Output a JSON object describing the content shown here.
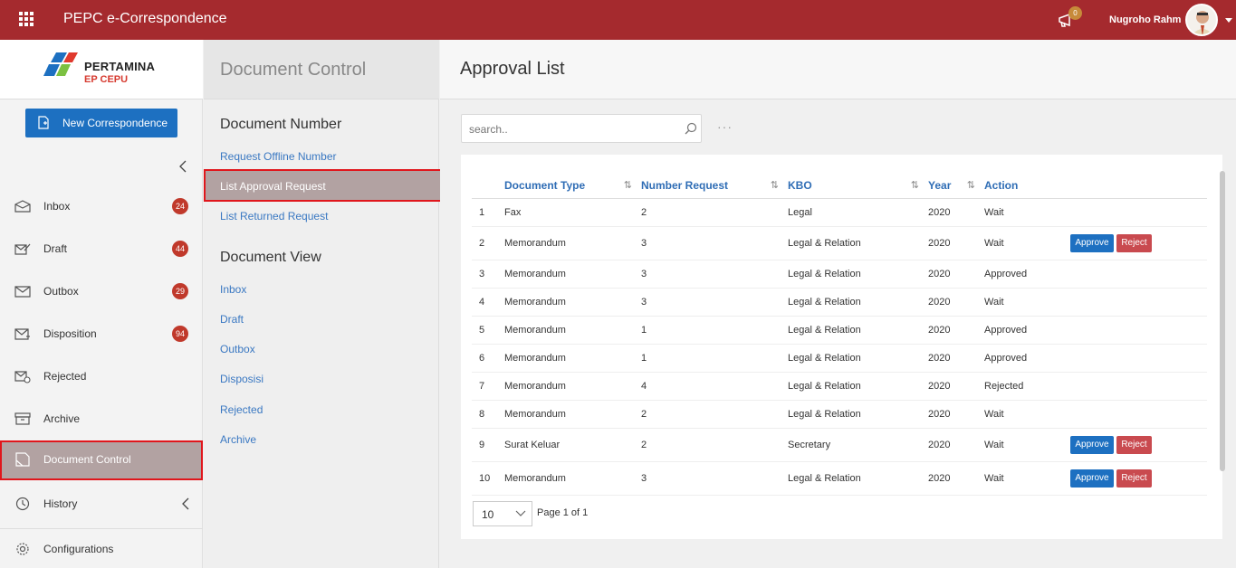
{
  "app": {
    "title": "PEPC e-Correspondence",
    "notification_count": "0",
    "user_name": "Nugroho Rahm"
  },
  "brand": {
    "name": "PERTAMINA",
    "sub": "EP CEPU"
  },
  "leftnav": {
    "new_button": "New Correspondence",
    "items": [
      {
        "label": "Inbox",
        "badge": "24",
        "icon": "inbox-icon"
      },
      {
        "label": "Draft",
        "badge": "44",
        "icon": "draft-icon"
      },
      {
        "label": "Outbox",
        "badge": "29",
        "icon": "outbox-icon"
      },
      {
        "label": "Disposition",
        "badge": "94",
        "icon": "disposition-icon"
      },
      {
        "label": "Rejected",
        "badge": "",
        "icon": "rejected-icon"
      },
      {
        "label": "Archive",
        "badge": "",
        "icon": "archive-icon"
      },
      {
        "label": "Document Control",
        "badge": "",
        "icon": "document-control-icon"
      },
      {
        "label": "History",
        "badge": "",
        "icon": "history-icon"
      },
      {
        "label": "Configurations",
        "badge": "",
        "icon": "gear-icon"
      }
    ]
  },
  "midpanel": {
    "title": "Document Control",
    "section1": "Document Number",
    "section1_links": [
      "Request Offline Number",
      "List Approval Request",
      "List Returned Request"
    ],
    "section2": "Document View",
    "section2_links": [
      "Inbox",
      "Draft",
      "Outbox",
      "Disposisi",
      "Rejected",
      "Archive"
    ]
  },
  "main": {
    "title": "Approval List",
    "search_placeholder": "search..",
    "columns": [
      "Document Type",
      "Number Request",
      "KBO",
      "Year",
      "Action"
    ],
    "rows": [
      {
        "no": "1",
        "type": "Fax",
        "num": "2",
        "kbo": "Legal",
        "year": "2020",
        "status": "Wait",
        "buttons": false
      },
      {
        "no": "2",
        "type": "Memorandum",
        "num": "3",
        "kbo": "Legal & Relation",
        "year": "2020",
        "status": "Wait",
        "buttons": true
      },
      {
        "no": "3",
        "type": "Memorandum",
        "num": "3",
        "kbo": "Legal & Relation",
        "year": "2020",
        "status": "Approved",
        "buttons": false
      },
      {
        "no": "4",
        "type": "Memorandum",
        "num": "3",
        "kbo": "Legal & Relation",
        "year": "2020",
        "status": "Wait",
        "buttons": false
      },
      {
        "no": "5",
        "type": "Memorandum",
        "num": "1",
        "kbo": "Legal & Relation",
        "year": "2020",
        "status": "Approved",
        "buttons": false
      },
      {
        "no": "6",
        "type": "Memorandum",
        "num": "1",
        "kbo": "Legal & Relation",
        "year": "2020",
        "status": "Approved",
        "buttons": false
      },
      {
        "no": "7",
        "type": "Memorandum",
        "num": "4",
        "kbo": "Legal & Relation",
        "year": "2020",
        "status": "Rejected",
        "buttons": false
      },
      {
        "no": "8",
        "type": "Memorandum",
        "num": "2",
        "kbo": "Legal & Relation",
        "year": "2020",
        "status": "Wait",
        "buttons": false
      },
      {
        "no": "9",
        "type": "Surat Keluar",
        "num": "2",
        "kbo": "Secretary",
        "year": "2020",
        "status": "Wait",
        "buttons": true
      },
      {
        "no": "10",
        "type": "Memorandum",
        "num": "3",
        "kbo": "Legal & Relation",
        "year": "2020",
        "status": "Wait",
        "buttons": true
      }
    ],
    "approve_label": "Approve",
    "reject_label": "Reject",
    "page_size": "10",
    "page_info": "Page 1 of 1"
  },
  "colors": {
    "topbar": "#a52a2e",
    "primary": "#1d70c1",
    "reject": "#c94a4f",
    "highlight_border": "#e0161c"
  }
}
